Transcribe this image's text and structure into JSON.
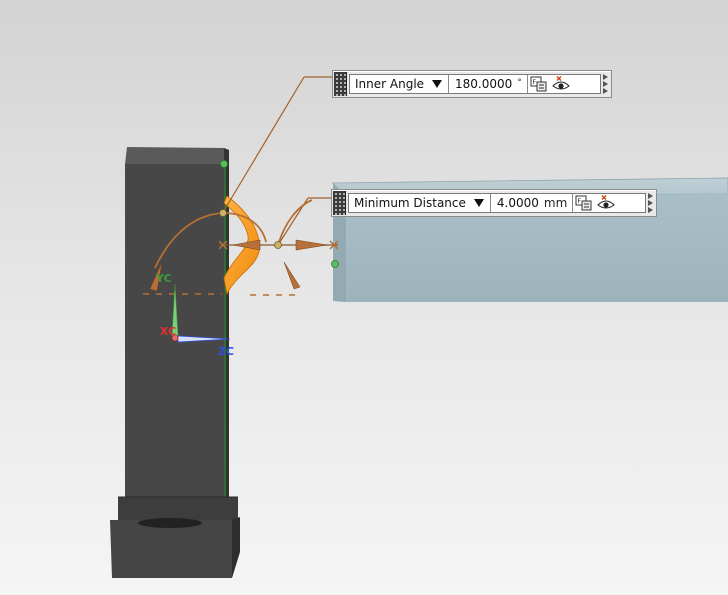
{
  "inner_angle_field": {
    "label": "Inner Angle",
    "value": "180.0000",
    "unit": "°"
  },
  "minimum_distance_field": {
    "label": "Minimum Distance",
    "value": "4.0000",
    "unit": "mm"
  },
  "triad": {
    "x_label": "XC",
    "y_label": "YC",
    "z_label": "ZC"
  },
  "colors": {
    "handle": "#b57035",
    "highlight": "#ff9c1a",
    "axis_x": "#e03030",
    "axis_y": "#3c9a3c",
    "axis_z": "#3050e0",
    "column": "#4a4a4a",
    "plate": "#a7bcc4"
  }
}
